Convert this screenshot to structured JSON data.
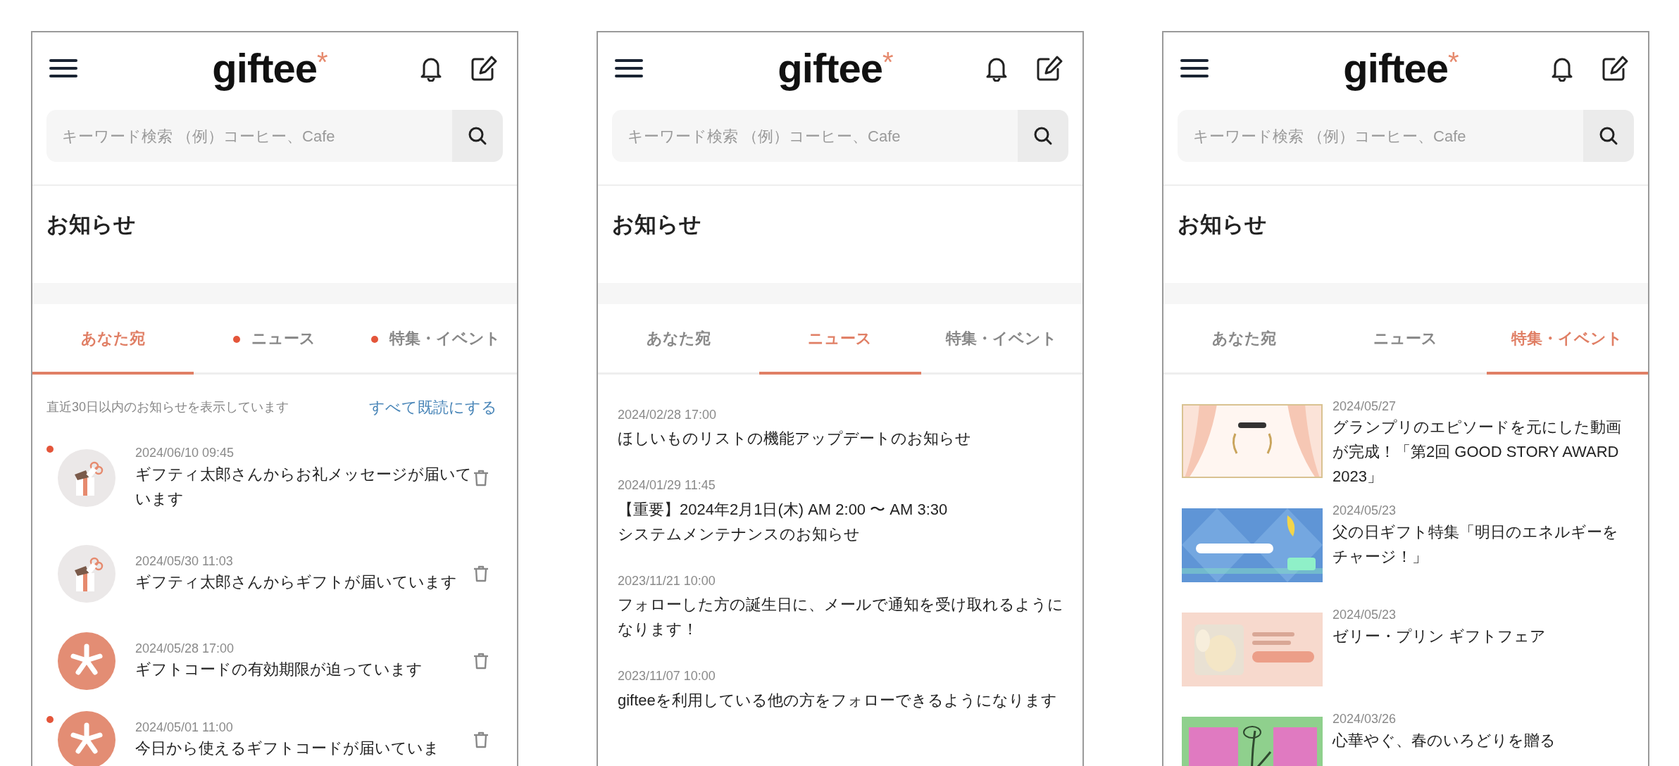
{
  "screens": [
    {
      "kind": "personal",
      "header": {
        "logo": "giftee",
        "logo_mark": "*"
      },
      "search": {
        "placeholder": "キーワード検索 （例）コーヒー、Cafe"
      },
      "page_title": "お知らせ",
      "tabs": [
        {
          "label": "あなた宛",
          "selected": true,
          "unread": false
        },
        {
          "label": "ニュース",
          "selected": false,
          "unread": true
        },
        {
          "label": "特集・イベント",
          "selected": false,
          "unread": true
        }
      ],
      "notice": "直近30日以内のお知らせを表示しています",
      "mark_all_read": "すべて既読にする",
      "items": [
        {
          "kind": "gift",
          "unread": true,
          "date": "2024/06/10 09:45",
          "title": "ギフティ太郎さんからお礼メッセージが届いています"
        },
        {
          "kind": "gift",
          "unread": false,
          "date": "2024/05/30 11:03",
          "title": "ギフティ太郎さんからギフトが届いています"
        },
        {
          "kind": "giftee",
          "unread": false,
          "date": "2024/05/28 17:00",
          "title": "ギフトコードの有効期限が迫っています"
        },
        {
          "kind": "giftee",
          "unread": true,
          "date": "2024/05/01 11:00",
          "title": "今日から使えるギフトコードが届いていま"
        }
      ]
    },
    {
      "kind": "news",
      "header": {
        "logo": "giftee",
        "logo_mark": "*"
      },
      "search": {
        "placeholder": "キーワード検索 （例）コーヒー、Cafe"
      },
      "page_title": "お知らせ",
      "tabs": [
        {
          "label": "あなた宛",
          "selected": false,
          "unread": false
        },
        {
          "label": "ニュース",
          "selected": true,
          "unread": false
        },
        {
          "label": "特集・イベント",
          "selected": false,
          "unread": false
        }
      ],
      "items": [
        {
          "date": "2024/02/28 17:00",
          "title": "ほしいものリストの機能アップデートのお知らせ"
        },
        {
          "date": "2024/01/29 11:45",
          "title": "【重要】2024年2月1日(木) AM 2:00 〜 AM 3:30\nシステムメンテナンスのお知らせ"
        },
        {
          "date": "2023/11/21 10:00",
          "title": "フォローした方の誕生日に、メールで通知を受け取れるようになります！"
        },
        {
          "date": "2023/11/07 10:00",
          "title": "gifteeを利用している他の方をフォローできるようになります"
        }
      ]
    },
    {
      "kind": "features",
      "header": {
        "logo": "giftee",
        "logo_mark": "*"
      },
      "search": {
        "placeholder": "キーワード検索 （例）コーヒー、Cafe"
      },
      "page_title": "お知らせ",
      "tabs": [
        {
          "label": "あなた宛",
          "selected": false,
          "unread": false
        },
        {
          "label": "ニュース",
          "selected": false,
          "unread": false
        },
        {
          "label": "特集・イベント",
          "selected": true,
          "unread": false
        }
      ],
      "items": [
        {
          "kind": "picture",
          "date": "2024/05/27",
          "title": "グランプリのエピソードを元にした動画が完成！「第2回 GOOD STORY AWARD 2023」"
        },
        {
          "kind": "picture",
          "date": "2024/05/23",
          "title": "父の日ギフト特集「明日のエネルギーをチャージ！」"
        },
        {
          "kind": "picture",
          "date": "2024/05/23",
          "title": "ゼリー・プリン ギフトフェア"
        },
        {
          "kind": "picture",
          "date": "2024/03/26",
          "title": "心華やぐ、春のいろどりを贈る"
        }
      ]
    }
  ]
}
